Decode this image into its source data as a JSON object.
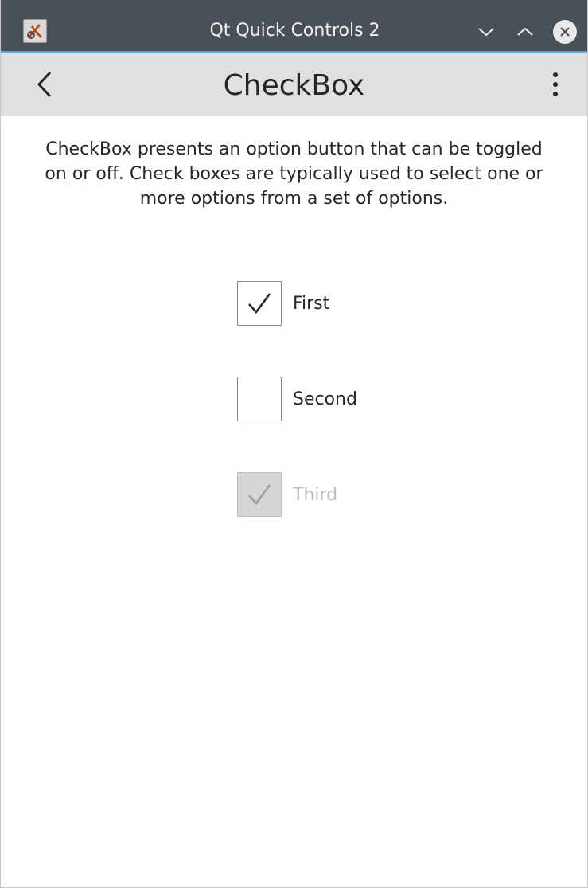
{
  "window": {
    "title": "Qt Quick Controls 2",
    "icon": "qt-app-icon",
    "controls": [
      "minimize-icon",
      "maximize-icon",
      "close-icon"
    ]
  },
  "toolbar": {
    "title": "CheckBox",
    "back_icon": "chevron-left-icon",
    "menu_icon": "vertical-dots-menu-icon"
  },
  "content": {
    "description": "CheckBox presents an option button that can be toggled on or off. Check boxes are typically used to select one or more options from a set of options.",
    "checkboxes": [
      {
        "label": "First",
        "checked": true,
        "enabled": true
      },
      {
        "label": "Second",
        "checked": false,
        "enabled": true
      },
      {
        "label": "Third",
        "checked": true,
        "enabled": false
      }
    ]
  },
  "colors": {
    "titlebar": "#4a5057",
    "titlebar_accent": "#3daee9",
    "toolbar": "#e0e0e0",
    "text": "#262626",
    "disabled_text": "#bdbdbd"
  }
}
